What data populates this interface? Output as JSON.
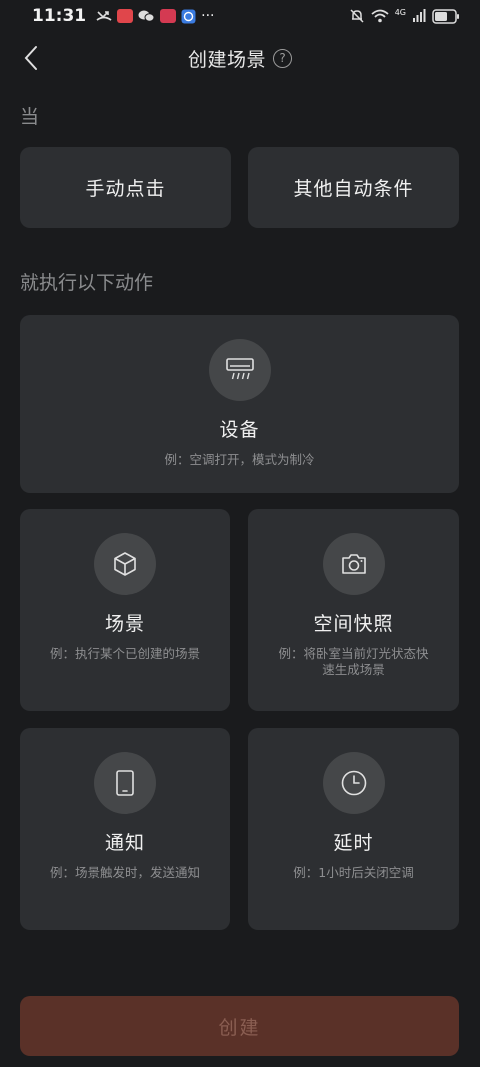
{
  "status_bar": {
    "time": "11:31",
    "more": "···",
    "network": "4G"
  },
  "header": {
    "title": "创建场景",
    "help": "?"
  },
  "when_section": {
    "label": "当",
    "triggers": [
      {
        "label": "手动点击"
      },
      {
        "label": "其他自动条件"
      }
    ]
  },
  "action_section": {
    "label": "就执行以下动作",
    "actions": [
      {
        "title": "设备",
        "desc": "例：空调打开，模式为制冷",
        "icon": "air-conditioner-icon"
      },
      {
        "title": "场景",
        "desc": "例：执行某个已创建的场景",
        "icon": "cube-icon"
      },
      {
        "title": "空间快照",
        "desc": "例：将卧室当前灯光状态快速生成场景",
        "icon": "camera-icon"
      },
      {
        "title": "通知",
        "desc": "例：场景触发时，发送通知",
        "icon": "phone-icon"
      },
      {
        "title": "延时",
        "desc": "例：1小时后关闭空调",
        "icon": "clock-icon"
      }
    ]
  },
  "create_button": {
    "label": "创建"
  },
  "colors": {
    "background": "#1a1b1d",
    "card": "#2d2f32",
    "icon_circle": "#454749",
    "create_button": "#5a3128"
  }
}
